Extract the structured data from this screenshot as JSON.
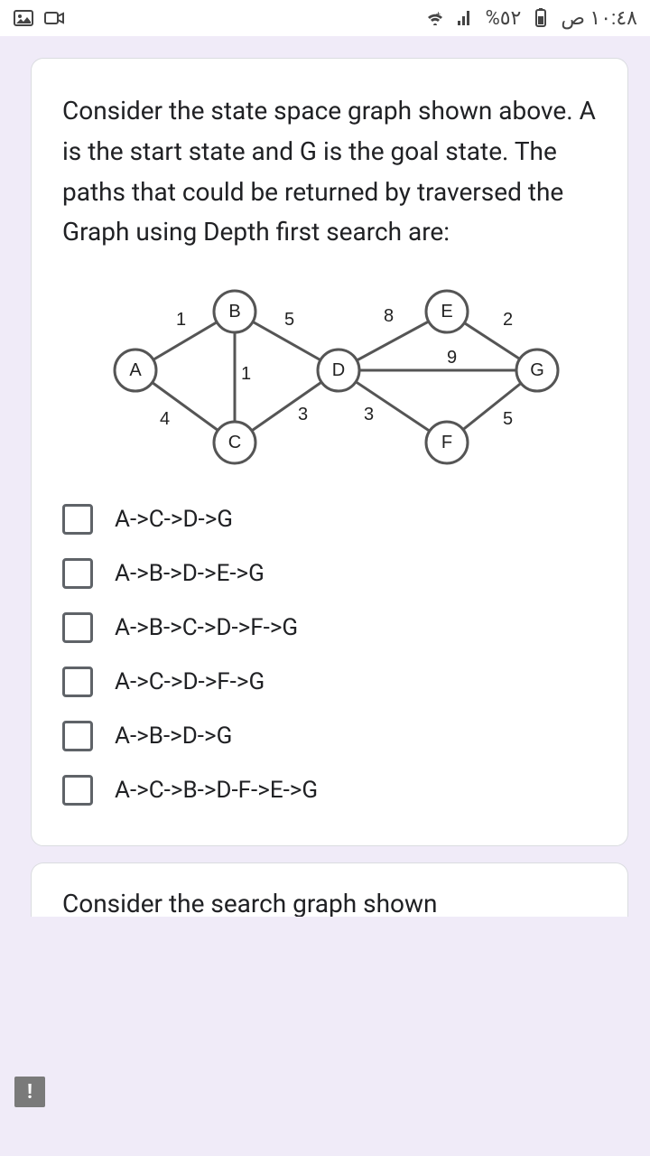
{
  "status": {
    "time": "١٠:٤٨ ص",
    "battery_pct": "٥٢%"
  },
  "question": {
    "text": "Consider the state space graph shown above. A is the start state and G is the goal state. The paths that could be returned by traversed the Graph using Depth first search are:"
  },
  "graph": {
    "nodes": {
      "A": "A",
      "B": "B",
      "C": "C",
      "D": "D",
      "E": "E",
      "F": "F",
      "G": "G"
    },
    "edges": {
      "AB": "1",
      "AC": "4",
      "BC": "1",
      "BD": "5",
      "CD": "3",
      "DE": "8",
      "DF": "3",
      "DG": "9",
      "EG": "2",
      "FG": "5"
    }
  },
  "options": [
    {
      "label": "A->C->D->G"
    },
    {
      "label": "A->B->D->E->G"
    },
    {
      "label": "A->B->C->D->F->G"
    },
    {
      "label": "A->C->D->F->G"
    },
    {
      "label": "A->B->D->G"
    },
    {
      "label": "A->C->B->D-F->E->G"
    }
  ],
  "next_card": {
    "text": "Consider the search graph shown"
  }
}
